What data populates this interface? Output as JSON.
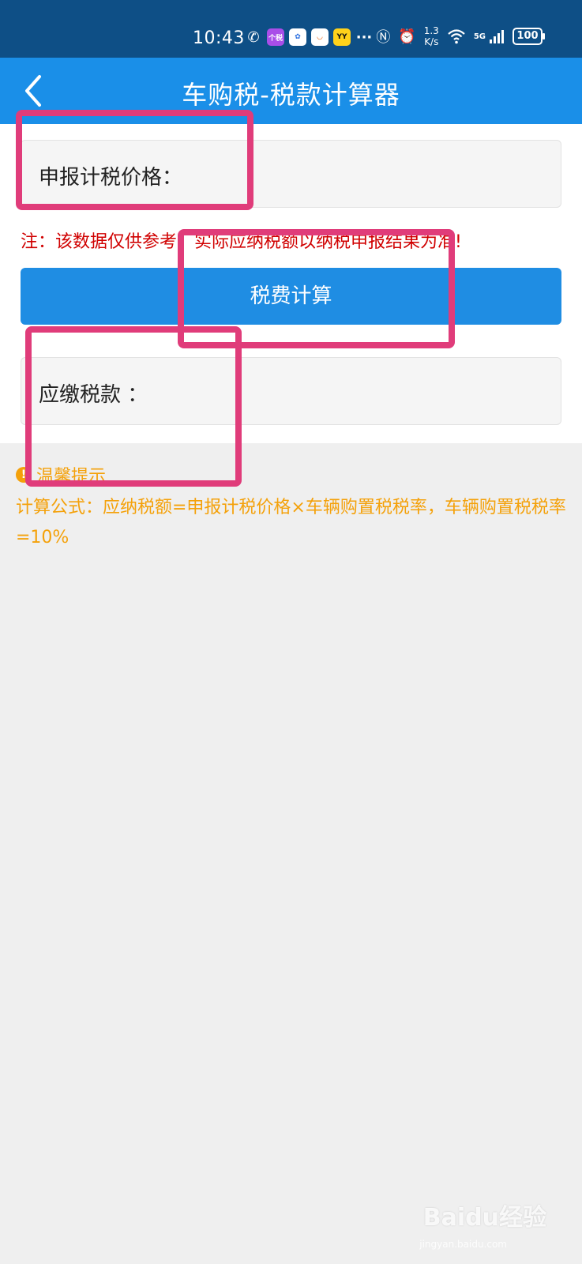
{
  "status_bar": {
    "time": "10:43",
    "app_icons": [
      "wechat-icon",
      "gesui-app-icon",
      "baidu-app-icon",
      "taobao-app-icon",
      "yy-app-icon"
    ],
    "gesui_label": "个税",
    "more": "···",
    "net_speed_value": "1.3",
    "net_speed_unit": "K/s",
    "network": "5G",
    "battery": "100"
  },
  "header": {
    "title": "车购税-税款计算器",
    "background": "#1a8fe8"
  },
  "form": {
    "price_label": "申报计税价格：",
    "note": "注：该数据仅供参考，实际应纳税额以纳税申报结果为准!",
    "calc_button_label": "税费计算",
    "result_label": "应缴税款 ：",
    "button_color": "#1f8de3"
  },
  "tips": {
    "title": "温馨提示",
    "body": "计算公式：应纳税额=申报计税价格×车辆购置税税率，车辆购置税税率=10%",
    "color": "#f4a10a"
  },
  "annotation_color": "#e03c7a",
  "watermark": {
    "brand": "Baidu经验",
    "url": "jingyan.baidu.com"
  }
}
